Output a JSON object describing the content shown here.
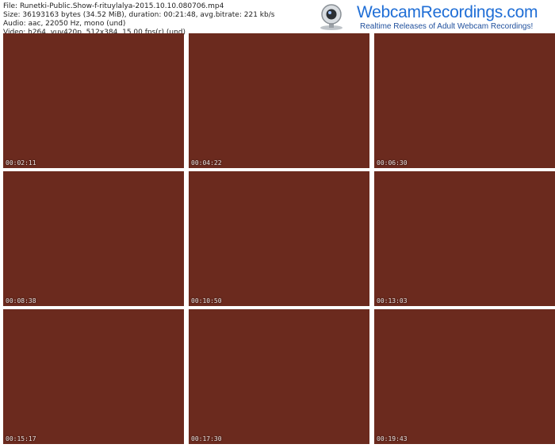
{
  "meta": {
    "file": "File: Runetki-Public.Show-f-rituylalya-2015.10.10.080706.mp4",
    "size": "Size: 36193163 bytes (34.52 MiB), duration: 00:21:48, avg.bitrate: 221 kb/s",
    "audio": "Audio: aac, 22050 Hz, mono (und)",
    "video": "Video: h264, yuv420p, 512x384, 15.00 fps(r) (und)"
  },
  "logo": {
    "title": "WebcamRecordings.com",
    "tagline": "Realtime Releases of Adult Webcam Recordings!"
  },
  "thumbnails": [
    {
      "timestamp": "00:02:11"
    },
    {
      "timestamp": "00:04:22"
    },
    {
      "timestamp": "00:06:30"
    },
    {
      "timestamp": "00:08:38"
    },
    {
      "timestamp": "00:10:50"
    },
    {
      "timestamp": "00:13:03"
    },
    {
      "timestamp": "00:15:17"
    },
    {
      "timestamp": "00:17:30"
    },
    {
      "timestamp": "00:19:43"
    }
  ],
  "colors": {
    "dress": "#d4134a",
    "wall": "#7a2a1c",
    "couch_light": "#f2f2f2",
    "couch_dark": "#1a1a1a"
  }
}
